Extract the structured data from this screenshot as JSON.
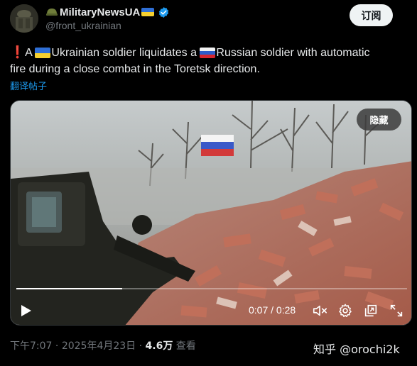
{
  "author": {
    "name": "MilitaryNewsUA",
    "handle": "@front_ukrainian",
    "verified": true
  },
  "header": {
    "subscribe_label": "订阅"
  },
  "post": {
    "exclaim": "❗",
    "line1_a": "A ",
    "line1_b": "Ukrainian soldier liquidates a ",
    "line1_c": "Russian soldier with automatic",
    "line2": "fire during a close combat in the Toretsk direction.",
    "translate_label": "翻译帖子"
  },
  "video": {
    "hide_label": "隐藏",
    "current_time": "0:07",
    "separator": " / ",
    "duration": "0:28",
    "progress_fraction": 0.27
  },
  "meta": {
    "time": "下午7:07",
    "dot": " · ",
    "date": "2025年4月23日",
    "views": "4.6万",
    "views_label": " 查看"
  },
  "watermark": "知乎 @orochi2k",
  "colors": {
    "accent": "#1d9bf0",
    "background": "#000000",
    "verified": "#1d9bf0"
  }
}
